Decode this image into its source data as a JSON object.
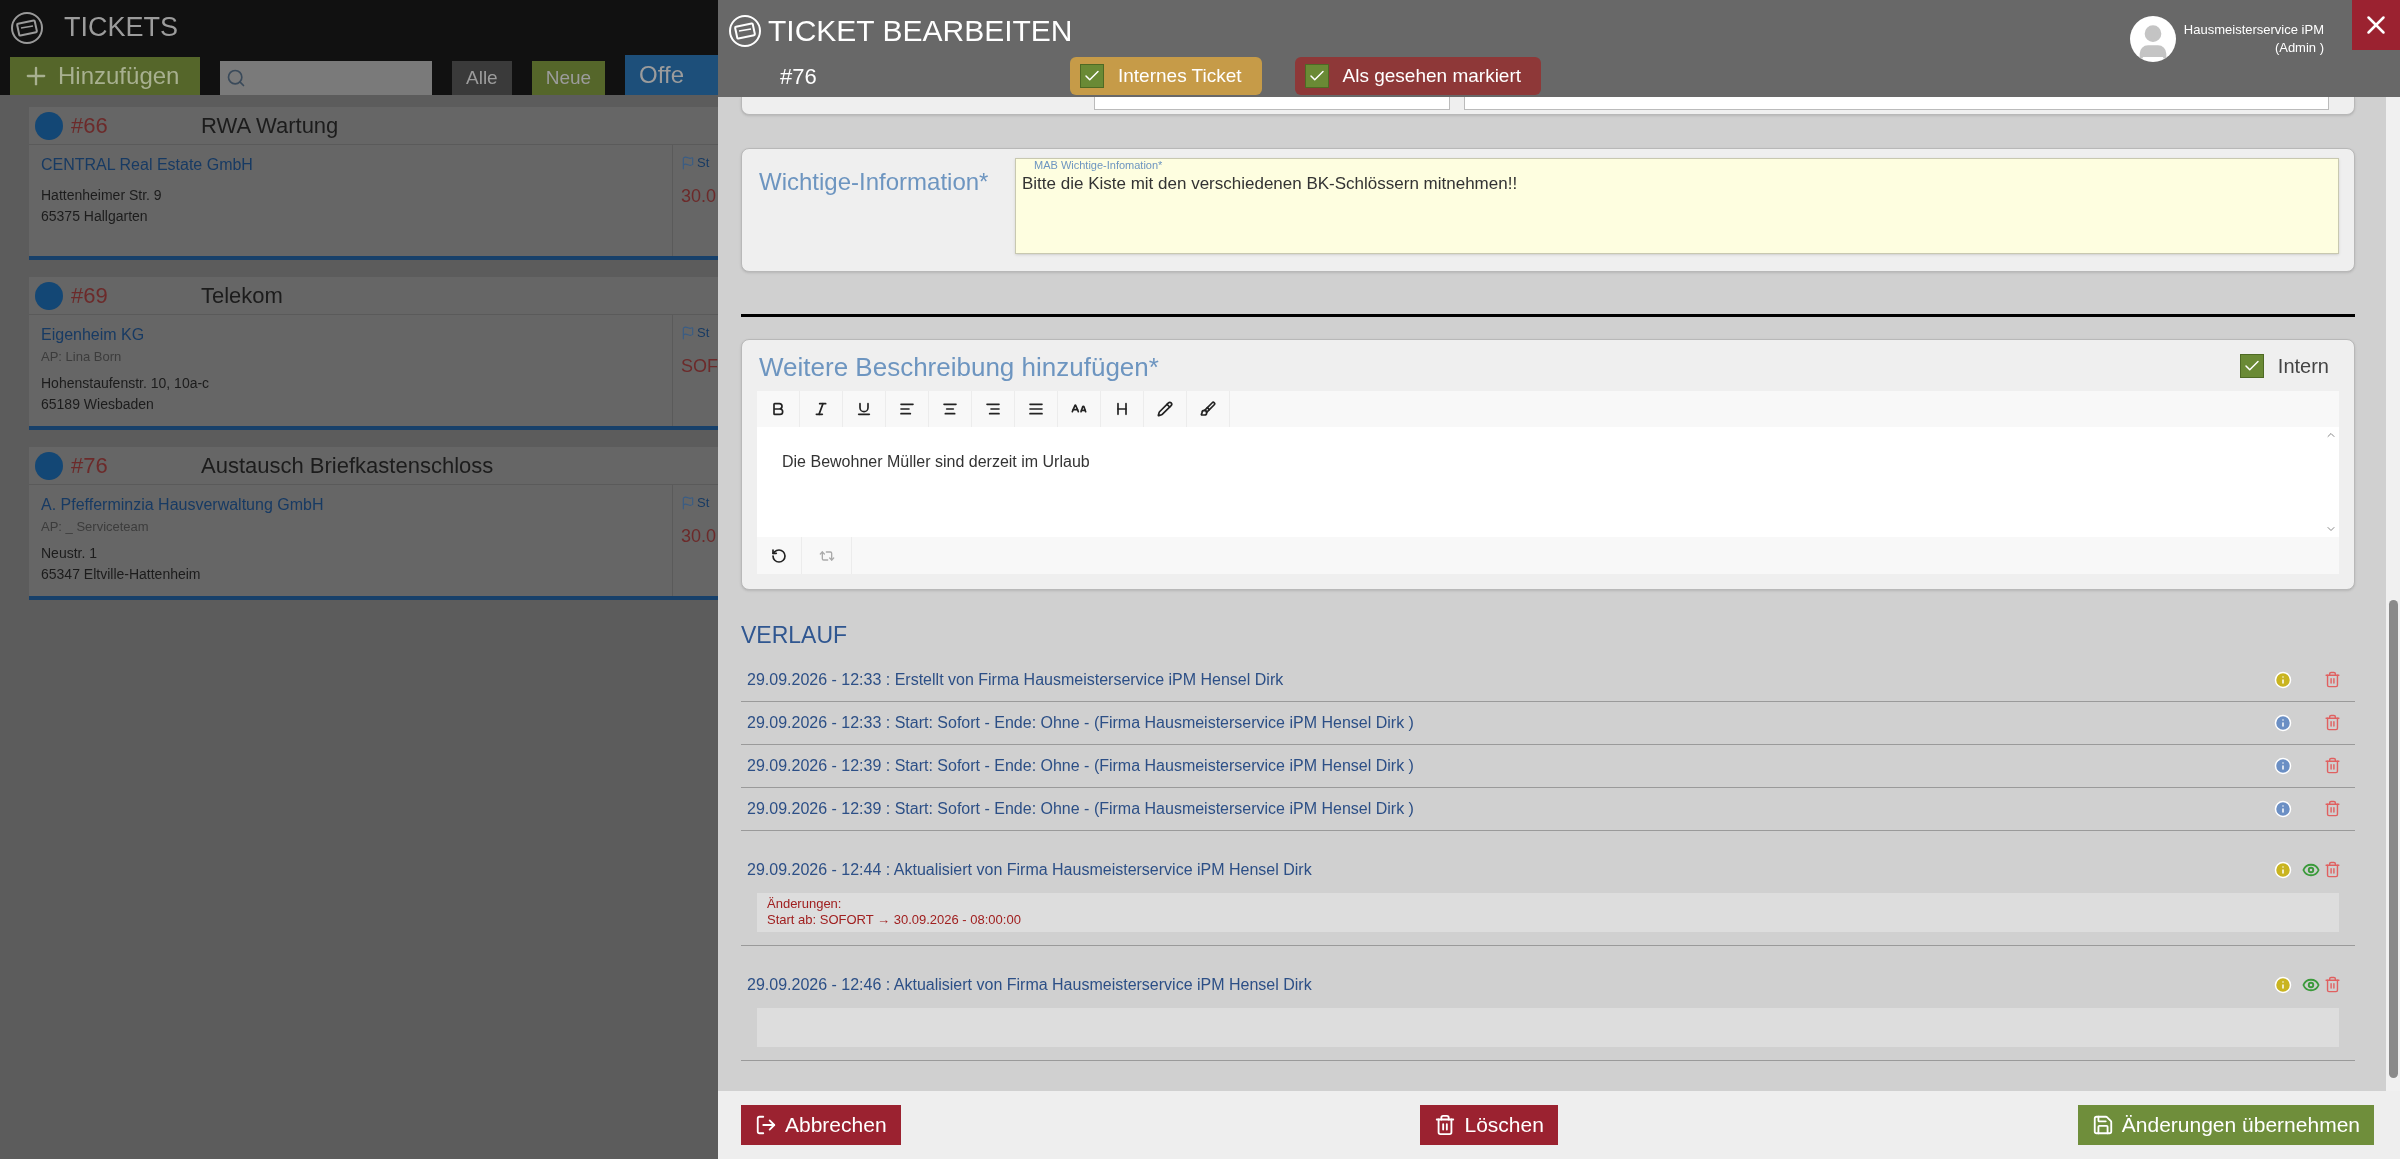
{
  "background_page": {
    "title": "TICKETS",
    "add_button": "Hinzufügen",
    "filters": [
      {
        "label": "Alle",
        "color": "#3a3a3a"
      },
      {
        "label": "Neue",
        "color": "#55662a"
      },
      {
        "label": "Offe",
        "color": "#1d4f7a"
      }
    ],
    "tickets": [
      {
        "number": "#66",
        "title": "RWA Wartung",
        "company": "CENTRAL Real Estate GmbH",
        "street": "Hattenheimer Str. 9",
        "city": "65375 Hallgarten",
        "status_label": "St",
        "status_value": "30.0"
      },
      {
        "number": "#69",
        "title": "Telekom",
        "company": "Eigenheim KG",
        "contact": "AP: Lina Born",
        "street": "Hohenstaufenstr. 10, 10a-c",
        "city": "65189 Wiesbaden",
        "status_label": "St",
        "status_value": "SOF"
      },
      {
        "number": "#76",
        "title": "Austausch Briefkastenschloss",
        "company": "A. Pfefferminzia Hausverwaltung GmbH",
        "contact": "AP: _ Serviceteam",
        "street": "Neustr. 1",
        "city": "65347 Eltville-Hattenheim",
        "status_label": "St",
        "status_value": "30.0"
      }
    ]
  },
  "modal": {
    "title": "TICKET BEARBEITEN",
    "ticket_number": "#76",
    "toggles": [
      {
        "label": "Internes Ticket",
        "checked": true,
        "color": "#c69b48"
      },
      {
        "label": "Als gesehen markiert",
        "checked": true,
        "color": "#8e3838"
      }
    ],
    "user": {
      "name": "Hausmeisterservice iPM",
      "role": "(Admin )"
    },
    "important": {
      "label": "Wichtige-Information*",
      "field_label": "MAB Wichtige-Infomation*",
      "value": "Bitte die Kiste mit den verschiedenen BK-Schlössern mitnehmen!!"
    },
    "description": {
      "label": "Weitere Beschreibung hinzufügen*",
      "intern": {
        "label": "Intern",
        "checked": true
      },
      "text": "Die Bewohner Müller sind derzeit im Urlaub"
    },
    "history": {
      "title": "VERLAUF",
      "entries": [
        {
          "kind": "plain",
          "text": "29.09.2026 - 12:33 : Erstellt von Firma Hausmeisterservice iPM Hensel Dirk",
          "color": "#c9b41f",
          "seen": false
        },
        {
          "kind": "plain",
          "text": "29.09.2026 - 12:33 : Start: Sofort - Ende: Ohne - (Firma Hausmeisterservice iPM Hensel Dirk )",
          "color": "#6b8fc4",
          "seen": false
        },
        {
          "kind": "plain",
          "text": "29.09.2026 - 12:39 : Start: Sofort - Ende: Ohne - (Firma Hausmeisterservice iPM Hensel Dirk )",
          "color": "#6b8fc4",
          "seen": false
        },
        {
          "kind": "plain",
          "text": "29.09.2026 - 12:39 : Start: Sofort - Ende: Ohne - (Firma Hausmeisterservice iPM Hensel Dirk )",
          "color": "#6b8fc4",
          "seen": false
        },
        {
          "kind": "update",
          "text": "29.09.2026 - 12:44 : Aktualisiert von Firma Hausmeisterservice iPM Hensel Dirk",
          "color": "#c9b41f",
          "seen": true,
          "details": [
            "Änderungen:",
            "Start ab: SOFORT → 30.09.2026 - 08:00:00"
          ]
        },
        {
          "kind": "update",
          "text": "29.09.2026 - 12:46 : Aktualisiert von Firma Hausmeisterservice iPM Hensel Dirk",
          "color": "#c9b41f",
          "seen": true
        }
      ]
    },
    "buttons": [
      {
        "label": "Abbrechen",
        "kind": "cancel"
      },
      {
        "label": "Löschen",
        "kind": "delete"
      },
      {
        "label": "Änderungen übernehmen",
        "kind": "save"
      }
    ]
  }
}
